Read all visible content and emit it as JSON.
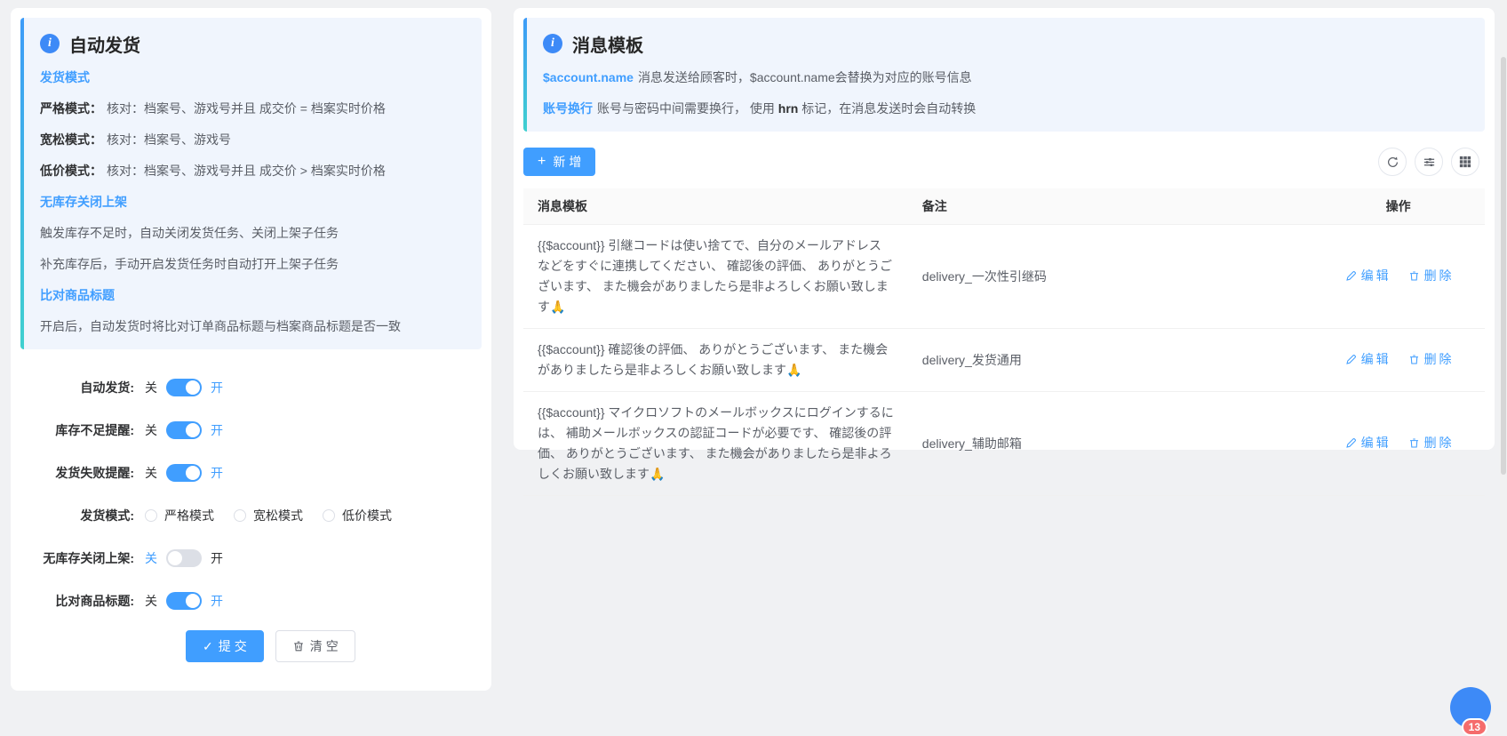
{
  "colors": {
    "accent": "#409eff",
    "toggle_off": "#dcdfe6",
    "info_box_bg": "#f0f5fd",
    "info_border_gradient": [
      "#3d9bf8",
      "#3fd0cf"
    ],
    "badge_red": "#f56c6c",
    "table_header_bg": "#fafafa"
  },
  "icons": {
    "info": "i",
    "plus": "+",
    "check": "✓",
    "refresh": "circular-arrow",
    "density": "horizontal-sliders",
    "columns": "grid-3x3",
    "edit": "pencil",
    "delete": "trash",
    "clear": "trash"
  },
  "left_panel": {
    "title": "自动发货",
    "info_sections": [
      {
        "heading": "发货模式",
        "items": [
          {
            "b": "严格模式：",
            "t": "核对：档案号、游戏号并且 成交价 = 档案实时价格"
          },
          {
            "b": "宽松模式：",
            "t": "核对：档案号、游戏号"
          },
          {
            "b": "低价模式：",
            "t": "核对：档案号、游戏号并且 成交价 > 档案实时价格"
          }
        ]
      },
      {
        "heading": "无库存关闭上架",
        "items": [
          {
            "b": "",
            "t": "触发库存不足时，自动关闭发货任务、关闭上架子任务"
          },
          {
            "b": "",
            "t": "补充库存后，手动开启发货任务时自动打开上架子任务"
          }
        ]
      },
      {
        "heading": "比对商品标题",
        "items": [
          {
            "b": "",
            "t": "开启后，自动发货时将比对订单商品标题与档案商品标题是否一致"
          }
        ]
      }
    ],
    "form": {
      "rows": [
        {
          "label": "自动发货:",
          "off": "关",
          "on": "开",
          "state": "on"
        },
        {
          "label": "库存不足提醒:",
          "off": "关",
          "on": "开",
          "state": "on"
        },
        {
          "label": "发货失败提醒:",
          "off": "关",
          "on": "开",
          "state": "on"
        },
        {
          "label": "发货模式:",
          "options": [
            "严格模式",
            "宽松模式",
            "低价模式"
          ],
          "selected": ""
        },
        {
          "label": "无库存关闭上架:",
          "off": "关",
          "on": "开",
          "state": "off"
        },
        {
          "label": "比对商品标题:",
          "off": "关",
          "on": "开",
          "state": "on"
        }
      ],
      "submit_label": "提交",
      "clear_label": "清空"
    }
  },
  "right_panel": {
    "title": "消息模板",
    "info_lines": [
      {
        "link": "$account.name",
        "text": "消息发送给顾客时，$account.name会替换为对应的账号信息"
      },
      {
        "link": "账号换行",
        "text_before": "账号与密码中间需要换行， 使用",
        "code": "hrn",
        "text_after": "标记，在消息发送时会自动转换"
      }
    ],
    "toolbar": {
      "add_label": "新增"
    },
    "table": {
      "headers": [
        "消息模板",
        "备注",
        "操作"
      ],
      "edit_label": "编辑",
      "delete_label": "删除",
      "rows": [
        {
          "template": "{{$account}} 引継コードは使い捨てで、自分のメールアドレスなどをすぐに連携してください、 確認後の評価、 ありがとうございます、 また機会がありましたら是非よろしくお願い致します🙏",
          "note": "delivery_一次性引继码"
        },
        {
          "template": "{{$account}} 確認後の評価、 ありがとうございます、 また機会がありましたら是非よろしくお願い致します🙏",
          "note": "delivery_发货通用"
        },
        {
          "template": "{{$account}} マイクロソフトのメールボックスにログインするには、 補助メールボックスの認証コードが必要です、 確認後の評価、 ありがとうございます、 また機会がありましたら是非よろしくお願い致します🙏",
          "note": "delivery_辅助邮箱"
        }
      ]
    }
  },
  "floating_button": {
    "badge_count": "13"
  }
}
